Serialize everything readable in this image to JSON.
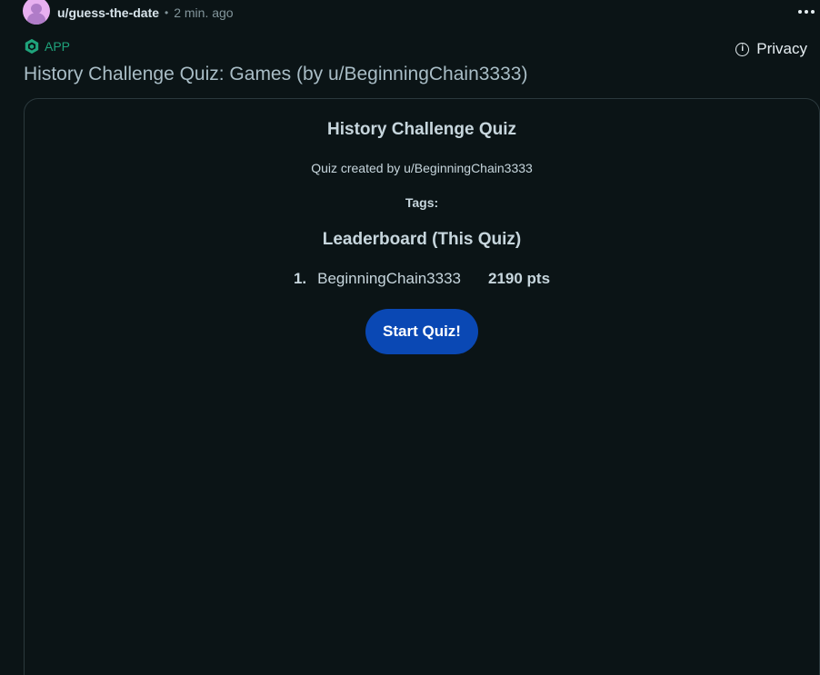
{
  "post": {
    "author": "u/guess-the-date",
    "separator": "•",
    "timestamp": "2 min. ago",
    "app_label": "APP",
    "privacy_label": "Privacy",
    "title": "History Challenge Quiz: Games (by u/BeginningChain3333)"
  },
  "quiz": {
    "title": "History Challenge Quiz",
    "creator": "Quiz created by u/BeginningChain3333",
    "tags_label": "Tags:",
    "leaderboard_title": "Leaderboard (This Quiz)",
    "leaderboard": [
      {
        "rank": "1.",
        "player": "BeginningChain3333",
        "points": "2190 pts"
      }
    ],
    "start_label": "Start Quiz!"
  },
  "colors": {
    "background": "#0b1416",
    "accent_green": "#1fa37b",
    "button_blue": "#0a48b4",
    "card_border": "#2b393d"
  },
  "icons": {
    "avatar": "snoo-avatar-icon",
    "more": "more-options-icon",
    "app": "devvit-app-icon",
    "info": "info-icon"
  }
}
